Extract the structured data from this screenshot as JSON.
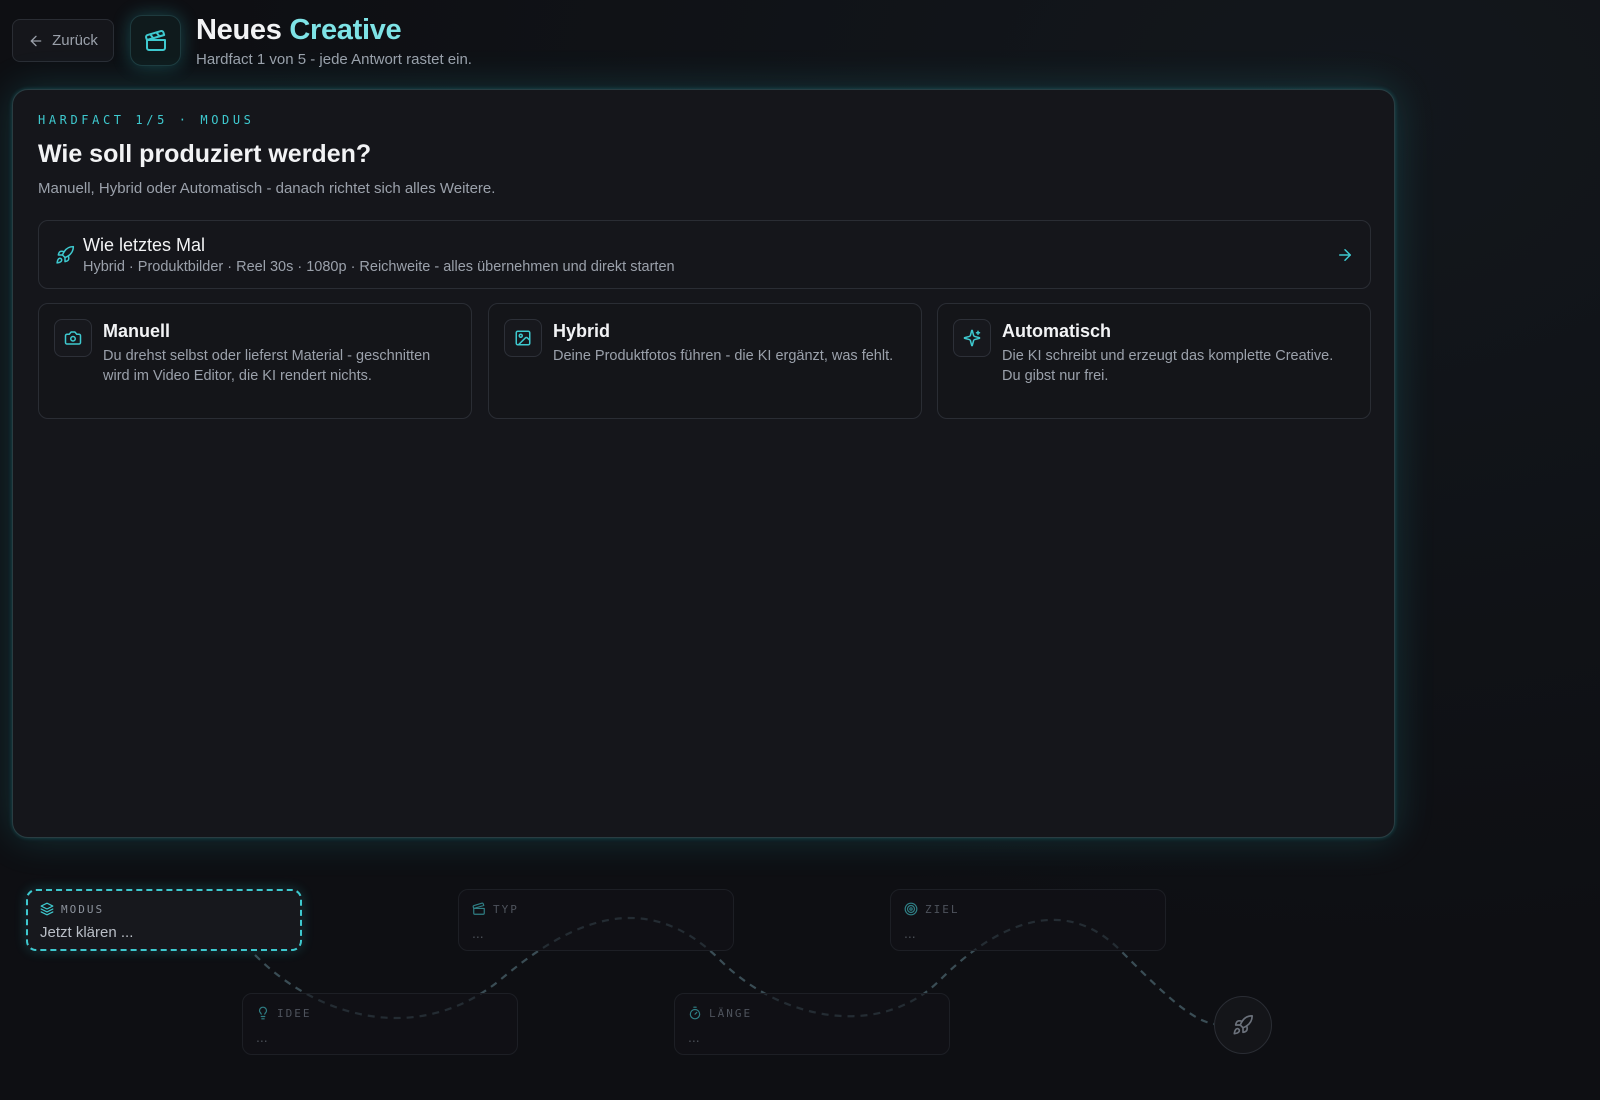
{
  "header": {
    "back_label": "Zurück",
    "title_part1": "Neues ",
    "title_part2": "Creative",
    "subtitle": "Hardfact 1 von 5 - jede Antwort rastet ein."
  },
  "question": {
    "eyebrow": "HARDFACT 1/5 · MODUS",
    "title": "Wie soll produziert werden?",
    "subtitle": "Manuell, Hybrid oder Automatisch - danach richtet sich alles Weitere."
  },
  "last_time": {
    "title": "Wie letztes Mal",
    "description": "Hybrid · Produktbilder · Reel 30s · 1080p · Reichweite - alles übernehmen und direkt starten",
    "icon": "rocket-icon"
  },
  "options": [
    {
      "title": "Manuell",
      "description": "Du drehst selbst oder lieferst Material - geschnitten wird im Video Editor, die KI rendert nichts.",
      "icon": "camera-icon"
    },
    {
      "title": "Hybrid",
      "description": "Deine Produktfotos führen - die KI ergänzt, was fehlt.",
      "icon": "image-icon"
    },
    {
      "title": "Automatisch",
      "description": "Die KI schreibt und erzeugt das komplette Creative. Du gibst nur frei.",
      "icon": "sparkles-icon"
    }
  ],
  "steps": [
    {
      "label": "MODUS",
      "value": "Jetzt klären ...",
      "icon": "layers-icon",
      "active": true
    },
    {
      "label": "IDEE",
      "value": "...",
      "icon": "lightbulb-icon"
    },
    {
      "label": "TYP",
      "value": "...",
      "icon": "clapperboard-icon"
    },
    {
      "label": "LÄNGE",
      "value": "...",
      "icon": "timer-icon"
    },
    {
      "label": "ZIEL",
      "value": "...",
      "icon": "target-icon"
    }
  ],
  "colors": {
    "accent": "#3ec9cf",
    "accent_light": "#7ee3e6",
    "background": "#0e0f13",
    "card": "#15161b"
  }
}
